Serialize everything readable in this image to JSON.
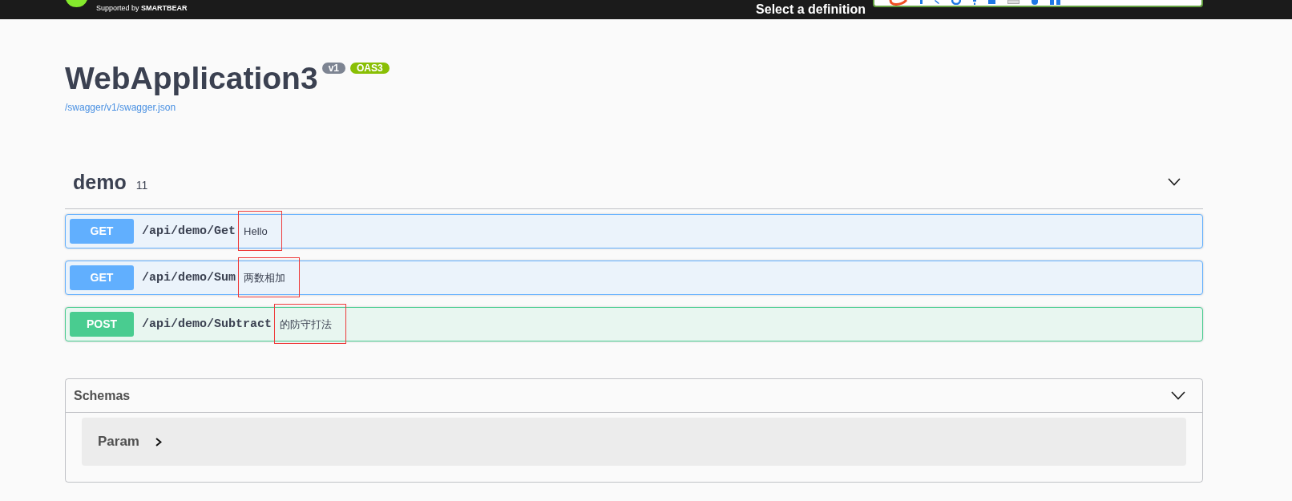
{
  "topbar": {
    "tagline": "Supported by **SMARTBEAR**",
    "definition_label": "Select a definition"
  },
  "info": {
    "title": "WebApplication3",
    "version": "v1",
    "spec_badge": "OAS3",
    "spec_link": "/swagger/v1/swagger.json"
  },
  "tag": {
    "name": "demo",
    "description": "11",
    "expanded": true,
    "operations": [
      {
        "kind": "get",
        "method": "GET",
        "path": "/api/demo/Get",
        "summary": "Hello",
        "highlighted": true
      },
      {
        "kind": "get",
        "method": "GET",
        "path": "/api/demo/Sum",
        "summary": "两数相加",
        "highlighted": true
      },
      {
        "kind": "post",
        "method": "POST",
        "path": "/api/demo/Subtract",
        "summary": "的防守打法",
        "highlighted": true
      }
    ]
  },
  "schemas": {
    "title": "Schemas",
    "expanded": true,
    "models": [
      {
        "name": "Param",
        "expanded": false
      }
    ]
  }
}
